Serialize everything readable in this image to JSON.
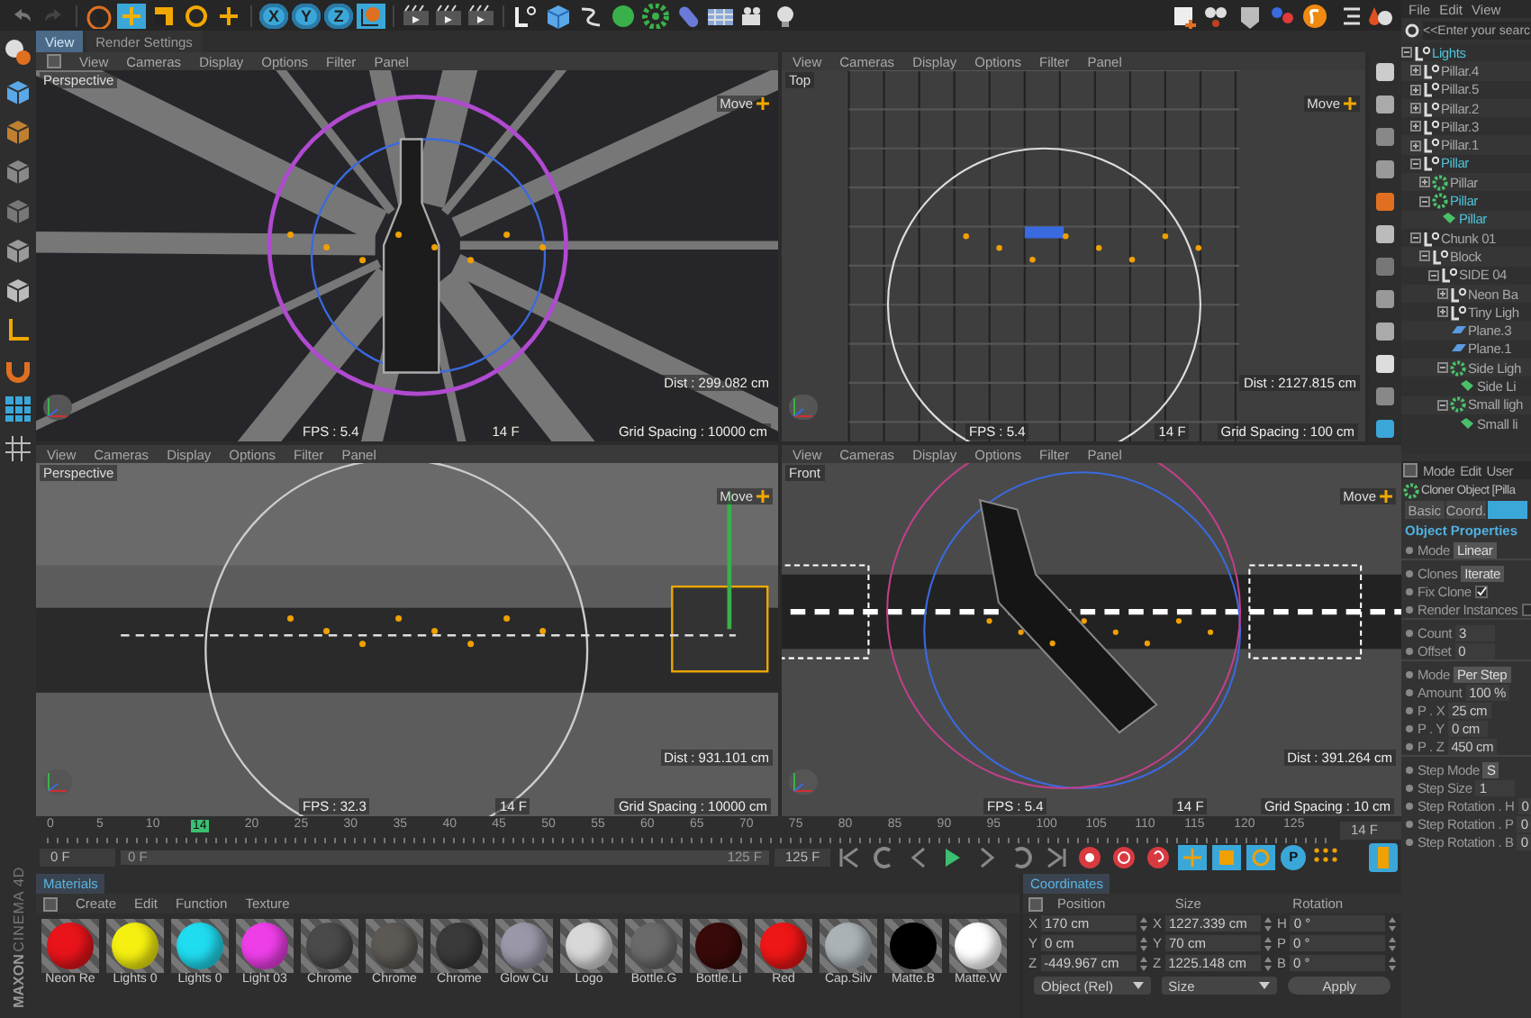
{
  "toolbar": {
    "axis_buttons": [
      {
        "label": "X",
        "on": true
      },
      {
        "label": "Y",
        "on": true
      },
      {
        "label": "Z",
        "on": true
      }
    ]
  },
  "view_tabs": [
    {
      "label": "View",
      "selected": true
    },
    {
      "label": "Render Settings",
      "selected": false
    }
  ],
  "viewports": [
    {
      "kind": "perspective",
      "menu": [
        "View",
        "Cameras",
        "Display",
        "Options",
        "Filter",
        "Panel"
      ],
      "label": "Perspective",
      "tool": "Move",
      "dist": "Dist : 299.082 cm",
      "fps": "FPS : 5.4",
      "frame": "14 F",
      "grid": "Grid Spacing : 10000 cm"
    },
    {
      "kind": "top",
      "menu": [
        "View",
        "Cameras",
        "Display",
        "Options",
        "Filter",
        "Panel"
      ],
      "label": "Top",
      "tool": "Move",
      "dist": "Dist : 2127.815 cm",
      "fps": "FPS : 5.4",
      "frame": "14 F",
      "grid": "Grid Spacing : 100 cm"
    },
    {
      "kind": "side",
      "menu": [
        "View",
        "Cameras",
        "Display",
        "Options",
        "Filter",
        "Panel"
      ],
      "label": "Perspective",
      "tool": "Move",
      "dist": "Dist : 931.101 cm",
      "fps": "FPS : 32.3",
      "frame": "14 F",
      "grid": "Grid Spacing : 10000 cm"
    },
    {
      "kind": "front",
      "menu": [
        "View",
        "Cameras",
        "Display",
        "Options",
        "Filter",
        "Panel"
      ],
      "label": "Front",
      "tool": "Move",
      "dist": "Dist : 391.264 cm",
      "fps": "FPS : 5.4",
      "frame": "14 F",
      "grid": "Grid Spacing : 10 cm"
    }
  ],
  "timeline": {
    "ticks_before": [
      "0",
      "5",
      "10"
    ],
    "ticks_after": [
      "20",
      "25",
      "30",
      "35",
      "40",
      "45",
      "50",
      "55",
      "60",
      "65",
      "70",
      "75",
      "80",
      "85",
      "90",
      "95",
      "100",
      "105",
      "110",
      "115",
      "120",
      "125"
    ],
    "playhead_label": "14",
    "level": 0.112,
    "current_frame": "14 F",
    "start_field": "0 F",
    "range": {
      "start": "0 F",
      "end": "125 F",
      "level": 1
    },
    "end_field": "125 F",
    "key_label": "P"
  },
  "materials": {
    "tab": "Materials",
    "menu": [
      "Create",
      "Edit",
      "Function",
      "Texture"
    ],
    "items": [
      {
        "name": "Neon Re",
        "color": "#e8141a"
      },
      {
        "name": "Lights 0",
        "color": "#f5f010"
      },
      {
        "name": "Lights 0",
        "color": "#20dcf0"
      },
      {
        "name": "Light 03",
        "color": "#ee3ee8"
      },
      {
        "name": "Chrome",
        "color": "#4a4a4a"
      },
      {
        "name": "Chrome",
        "color": "#5c5854"
      },
      {
        "name": "Chrome",
        "color": "#3a3a3a"
      },
      {
        "name": "Glow Cu",
        "color": "#9a98a8"
      },
      {
        "name": "Logo",
        "color": "#d8d8d8"
      },
      {
        "name": "Bottle.G",
        "color": "#6a6a6a"
      },
      {
        "name": "Bottle.Li",
        "color": "#3a0a0a"
      },
      {
        "name": "Red",
        "color": "#ee1616"
      },
      {
        "name": "Cap.Silv",
        "color": "#aab2b6"
      },
      {
        "name": "Matte.B",
        "color": "#000000"
      },
      {
        "name": "Matte.W",
        "color": "#ffffff"
      }
    ]
  },
  "brand": {
    "line1": "MAXON",
    "line2": "CINEMA 4D"
  },
  "coordinates": {
    "tab": "Coordinates",
    "headers": [
      "Position",
      "Size",
      "Rotation"
    ],
    "rows": [
      [
        {
          "axis": "X",
          "value": "170 cm"
        },
        {
          "axis": "X",
          "value": "1227.339 cm"
        },
        {
          "axis": "H",
          "value": "0 °"
        }
      ],
      [
        {
          "axis": "Y",
          "value": "0 cm"
        },
        {
          "axis": "Y",
          "value": "70 cm"
        },
        {
          "axis": "P",
          "value": "0 °"
        }
      ],
      [
        {
          "axis": "Z",
          "value": "-449.967 cm"
        },
        {
          "axis": "Z",
          "value": "1225.148 cm"
        },
        {
          "axis": "B",
          "value": "0 °"
        }
      ]
    ],
    "dropdowns": [
      "Object (Rel)",
      "Size"
    ],
    "apply": "Apply"
  },
  "objects": {
    "menu": [
      "File",
      "Edit",
      "View"
    ],
    "search": {
      "placeholder": "<<Enter your searc"
    },
    "tree": [
      {
        "label": "Lights",
        "kind": "null",
        "selected": true,
        "expanded": true,
        "children": [
          {
            "label": "Pillar.4",
            "kind": "null",
            "selected": false,
            "expanded": false
          },
          {
            "label": "Pillar.5",
            "kind": "null",
            "selected": false,
            "expanded": false
          },
          {
            "label": "Pillar.2",
            "kind": "null",
            "selected": false,
            "expanded": false
          },
          {
            "label": "Pillar.3",
            "kind": "null",
            "selected": false,
            "expanded": false
          },
          {
            "label": "Pillar.1",
            "kind": "null",
            "selected": false,
            "expanded": false
          },
          {
            "label": "Pillar",
            "kind": "null",
            "selected": true,
            "expanded": true,
            "children": [
              {
                "label": "Pillar",
                "kind": "cloner",
                "selected": false,
                "expanded": false
              },
              {
                "label": "Pillar",
                "kind": "cloner",
                "selected": true,
                "expanded": true,
                "children": [
                  {
                    "label": "Pillar",
                    "kind": "light",
                    "selected": true
                  }
                ]
              }
            ]
          },
          {
            "label": "Chunk 01",
            "kind": "null",
            "selected": false,
            "expanded": true,
            "children": [
              {
                "label": "Block",
                "kind": "null",
                "selected": false,
                "expanded": true,
                "children": [
                  {
                    "label": "SIDE 04",
                    "kind": "null",
                    "selected": false,
                    "expanded": true,
                    "children": [
                      {
                        "label": "Neon Ba",
                        "kind": "null",
                        "selected": false,
                        "expanded": false
                      },
                      {
                        "label": "Tiny Ligh",
                        "kind": "null",
                        "selected": false,
                        "expanded": false
                      },
                      {
                        "label": "Plane.3",
                        "kind": "plane",
                        "selected": false
                      },
                      {
                        "label": "Plane.1",
                        "kind": "plane",
                        "selected": false
                      },
                      {
                        "label": "Side Ligh",
                        "kind": "cloner",
                        "selected": false,
                        "expanded": true,
                        "children": [
                          {
                            "label": "Side Li",
                            "kind": "light",
                            "selected": false
                          }
                        ]
                      },
                      {
                        "label": "Small ligh",
                        "kind": "cloner",
                        "selected": false,
                        "expanded": true,
                        "children": [
                          {
                            "label": "Small li",
                            "kind": "light",
                            "selected": false
                          }
                        ]
                      }
                    ]
                  }
                ]
              }
            ]
          }
        ]
      }
    ]
  },
  "attributes": {
    "menu": [
      "Mode",
      "Edit",
      "User"
    ],
    "title": "Cloner Object [Pilla",
    "tabs": [
      {
        "label": "Basic",
        "selected": false
      },
      {
        "label": "Coord.",
        "selected": false
      },
      {
        "selected": true
      }
    ],
    "section": "Object Properties",
    "rows": [
      {
        "kind": "dropdown",
        "label": "Mode",
        "value": "Linear"
      },
      {
        "kind": "dropdown",
        "label": "Clones",
        "value": "Iterate",
        "gap_before": true
      },
      {
        "kind": "check",
        "label": "Fix Clone",
        "checked": true
      },
      {
        "kind": "check",
        "label": "Render Instances",
        "checked": false
      },
      {
        "kind": "field",
        "label": "Count",
        "value": "3",
        "gap_before": true
      },
      {
        "kind": "field",
        "label": "Offset",
        "value": "0"
      },
      {
        "kind": "dropdown",
        "label": "Mode",
        "value": "Per Step",
        "gap_before": true
      },
      {
        "kind": "field",
        "label": "Amount",
        "value": "100 %"
      },
      {
        "kind": "field",
        "label": "P . X",
        "value": "25 cm"
      },
      {
        "kind": "field",
        "label": "P . Y",
        "value": "0 cm"
      },
      {
        "kind": "field",
        "label": "P . Z",
        "value": "450 cm"
      },
      {
        "kind": "dropdown",
        "label": "Step Mode",
        "value": "S",
        "gap_before": true
      },
      {
        "kind": "field",
        "label": "Step Size",
        "value": "1"
      },
      {
        "kind": "field",
        "label": "Step Rotation . H",
        "value": "0"
      },
      {
        "kind": "field",
        "label": "Step Rotation . P",
        "value": "0"
      },
      {
        "kind": "field",
        "label": "Step Rotation . B",
        "value": "0"
      }
    ]
  }
}
